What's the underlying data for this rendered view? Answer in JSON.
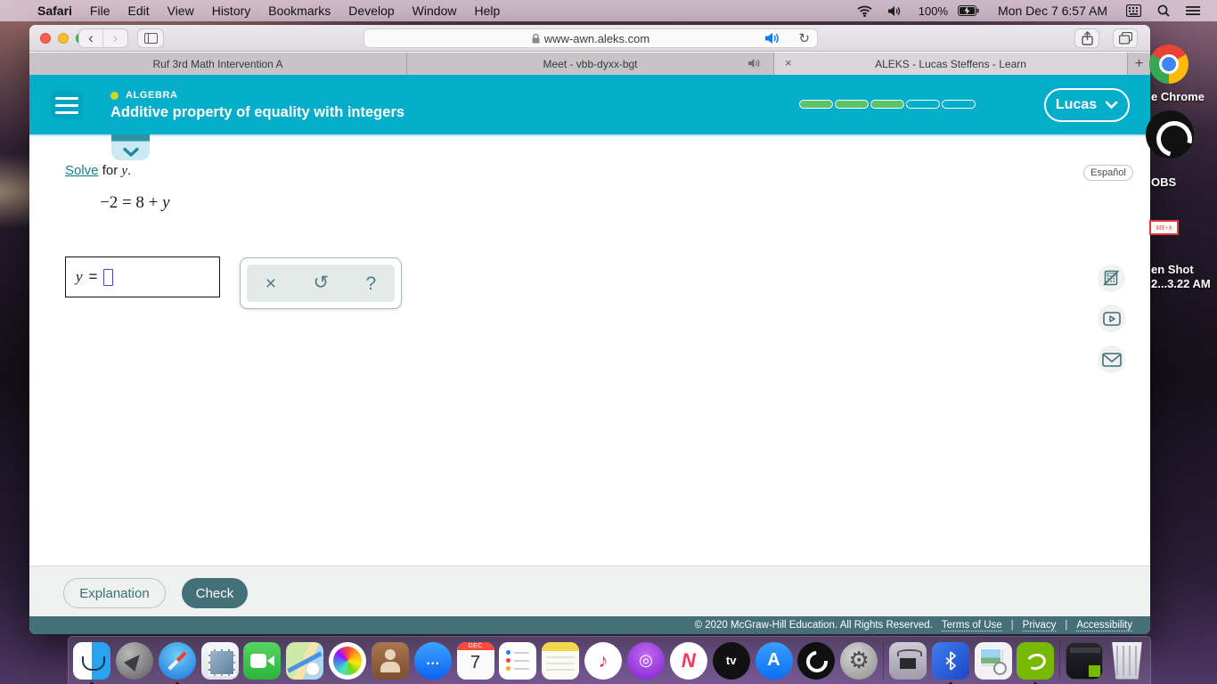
{
  "menu_bar": {
    "apple_icon": "",
    "items": [
      "Safari",
      "File",
      "Edit",
      "View",
      "History",
      "Bookmarks",
      "Develop",
      "Window",
      "Help"
    ],
    "status": {
      "battery_percent": "100%",
      "datetime": "Mon Dec 7  6:57 AM",
      "icons": [
        "wifi-icon",
        "volume-icon",
        "battery-charging-icon",
        "keyboard-icon",
        "search-icon",
        "list-icon"
      ]
    }
  },
  "browser": {
    "url": "www-awn.aleks.com",
    "reload_icon": "↻",
    "back_icon": "‹",
    "forward_icon": "›",
    "tabs": [
      {
        "label": "Ruf 3rd Math Intervention A",
        "active": false
      },
      {
        "label": "Meet - vbb-dyxx-bgt",
        "active": false,
        "audio_playing": true
      },
      {
        "label": "ALEKS - Lucas Steffens - Learn",
        "active": true,
        "close_icon": "×"
      }
    ],
    "new_tab_icon": "+"
  },
  "aleks": {
    "header": {
      "category": "ALGEBRA",
      "title": "Additive property of equality with integers",
      "user": "Lucas",
      "progress": {
        "total_segments": 5,
        "filled_segments": 3
      }
    },
    "espanol_label": "Español",
    "problem": {
      "link_text": "Solve",
      "mid_text": " for ",
      "variable": "y",
      "period": ".",
      "equation_lhs": "−2 = 8 + ",
      "equation_var": "y",
      "answer_var": "y",
      "answer_equals": "="
    },
    "palette": {
      "close_icon": "×",
      "undo_icon": "↺",
      "help_icon": "?"
    },
    "side_buttons": [
      "calculator-disabled-icon",
      "video-icon",
      "mail-icon"
    ],
    "buttons": {
      "explanation": "Explanation",
      "check": "Check"
    },
    "footer": {
      "copyright": "© 2020 McGraw-Hill Education. All Rights Reserved.",
      "links": [
        "Terms of Use",
        "Privacy",
        "Accessibility"
      ],
      "separator": "|"
    }
  },
  "desktop_icons": {
    "chrome_label": "e Chrome",
    "obs_label": "OBS",
    "screenshot_thumb_text": "MX+b",
    "screenshot_label_line1": "en Shot",
    "screenshot_label_line2": "2...3.22 AM"
  },
  "dock": {
    "items": [
      {
        "name": "finder",
        "running": true
      },
      {
        "name": "launchpad",
        "running": false
      },
      {
        "name": "safari",
        "running": true
      },
      {
        "name": "mail",
        "running": false
      },
      {
        "name": "facetime",
        "running": false
      },
      {
        "name": "maps",
        "running": false
      },
      {
        "name": "photos",
        "running": false
      },
      {
        "name": "contacts",
        "running": false
      },
      {
        "name": "messages",
        "running": false
      },
      {
        "name": "calendar",
        "running": false
      },
      {
        "name": "reminders",
        "running": false
      },
      {
        "name": "notes",
        "running": false
      },
      {
        "name": "music",
        "running": false
      },
      {
        "name": "podcasts",
        "running": false
      },
      {
        "name": "news",
        "running": false
      },
      {
        "name": "tv",
        "running": false
      },
      {
        "name": "app-store",
        "running": false
      },
      {
        "name": "obs",
        "running": false
      },
      {
        "name": "system-preferences",
        "running": false
      },
      {
        "name": "chip-programmer",
        "running": false
      },
      {
        "name": "bluetooth-utility",
        "running": true
      },
      {
        "name": "preview",
        "running": false
      },
      {
        "name": "nvidia-geforce",
        "running": true
      },
      {
        "name": "minimized-window",
        "running": false
      },
      {
        "name": "trash",
        "running": false
      }
    ],
    "calendar_month": "DEC",
    "calendar_day": "7",
    "tv_label": "tv",
    "appstore_label": "A",
    "messages_glyph": "…",
    "music_glyph": "♪",
    "podcasts_glyph": "◎",
    "news_glyph": "N",
    "sysprefs_glyph": "⚙"
  }
}
